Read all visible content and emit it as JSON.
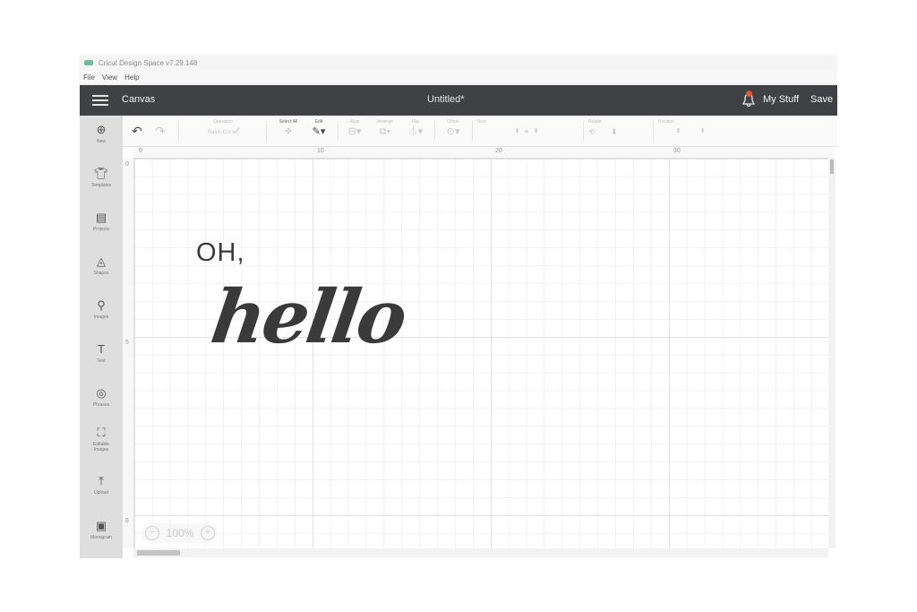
{
  "window": {
    "title": "Cricut Design Space   v7.29.148"
  },
  "menu": [
    "File",
    "View",
    "Help"
  ],
  "header": {
    "section": "Canvas",
    "doc_title": "Untitled*",
    "my_stuff": "My Stuff",
    "save": "Save"
  },
  "toolbar": {
    "operation": {
      "label": "Operation",
      "value": "Basic Cut"
    },
    "select_all": "Select All",
    "edit": "Edit",
    "align": "Align",
    "arrange": "Arrange",
    "flip": "Flip",
    "offset": "Offset",
    "size": "Size",
    "rotate": "Rotate",
    "position": "Position"
  },
  "sidebar": [
    {
      "label": "New",
      "icon": "plus-circle-icon"
    },
    {
      "label": "Templates",
      "icon": "shirt-icon"
    },
    {
      "label": "Projects",
      "icon": "clipboard-icon"
    },
    {
      "label": "Shapes",
      "icon": "shapes-icon"
    },
    {
      "label": "Images",
      "icon": "lightbulb-icon"
    },
    {
      "label": "Text",
      "icon": "text-icon"
    },
    {
      "label": "Phrases",
      "icon": "speech-icon"
    },
    {
      "label": "Editable Images",
      "icon": "editable-image-icon"
    },
    {
      "label": "Upload",
      "icon": "upload-icon"
    },
    {
      "label": "Monogram",
      "icon": "monogram-icon"
    }
  ],
  "rulers": {
    "top": [
      "0",
      "10",
      "20",
      "30"
    ],
    "left": [
      "0",
      "5",
      "8"
    ]
  },
  "canvas_text": {
    "line1": "OH,",
    "line2": "hello"
  },
  "zoom": {
    "level": "100%",
    "minus": "−",
    "plus": "+"
  },
  "colors": {
    "header_bg": "#3f4144",
    "sidebar_bg": "#dedede",
    "canvas_bg": "#ffffff",
    "notification": "#e8552b"
  }
}
